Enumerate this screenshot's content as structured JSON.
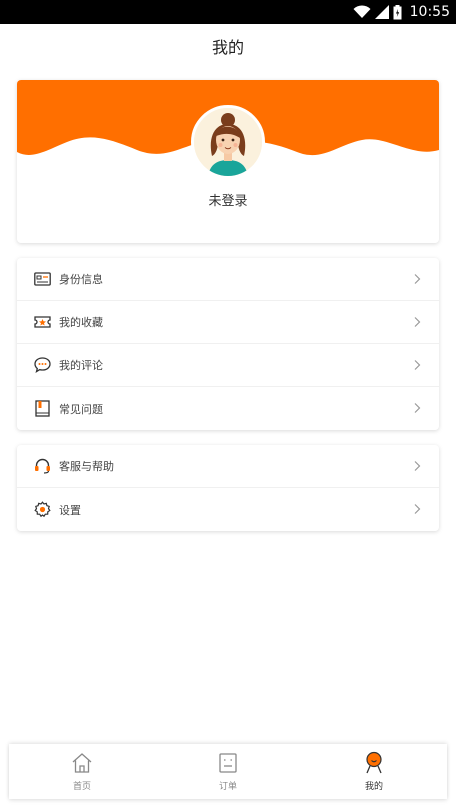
{
  "status": {
    "time": "10:55"
  },
  "header": {
    "title": "我的"
  },
  "profile": {
    "status": "未登录"
  },
  "menu_group_1": [
    {
      "label": "身份信息",
      "icon": "id-card-icon"
    },
    {
      "label": "我的收藏",
      "icon": "favorites-icon"
    },
    {
      "label": "我的评论",
      "icon": "comment-icon"
    },
    {
      "label": "常见问题",
      "icon": "faq-book-icon"
    }
  ],
  "menu_group_2": [
    {
      "label": "客服与帮助",
      "icon": "headset-icon"
    },
    {
      "label": "设置",
      "icon": "gear-icon"
    }
  ],
  "tabs": [
    {
      "label": "首页",
      "icon": "home-icon",
      "active": false
    },
    {
      "label": "订单",
      "icon": "order-icon",
      "active": false
    },
    {
      "label": "我的",
      "icon": "profile-icon",
      "active": true
    }
  ],
  "colors": {
    "accent": "#ff6f00",
    "text": "#333333",
    "muted": "#888888"
  }
}
